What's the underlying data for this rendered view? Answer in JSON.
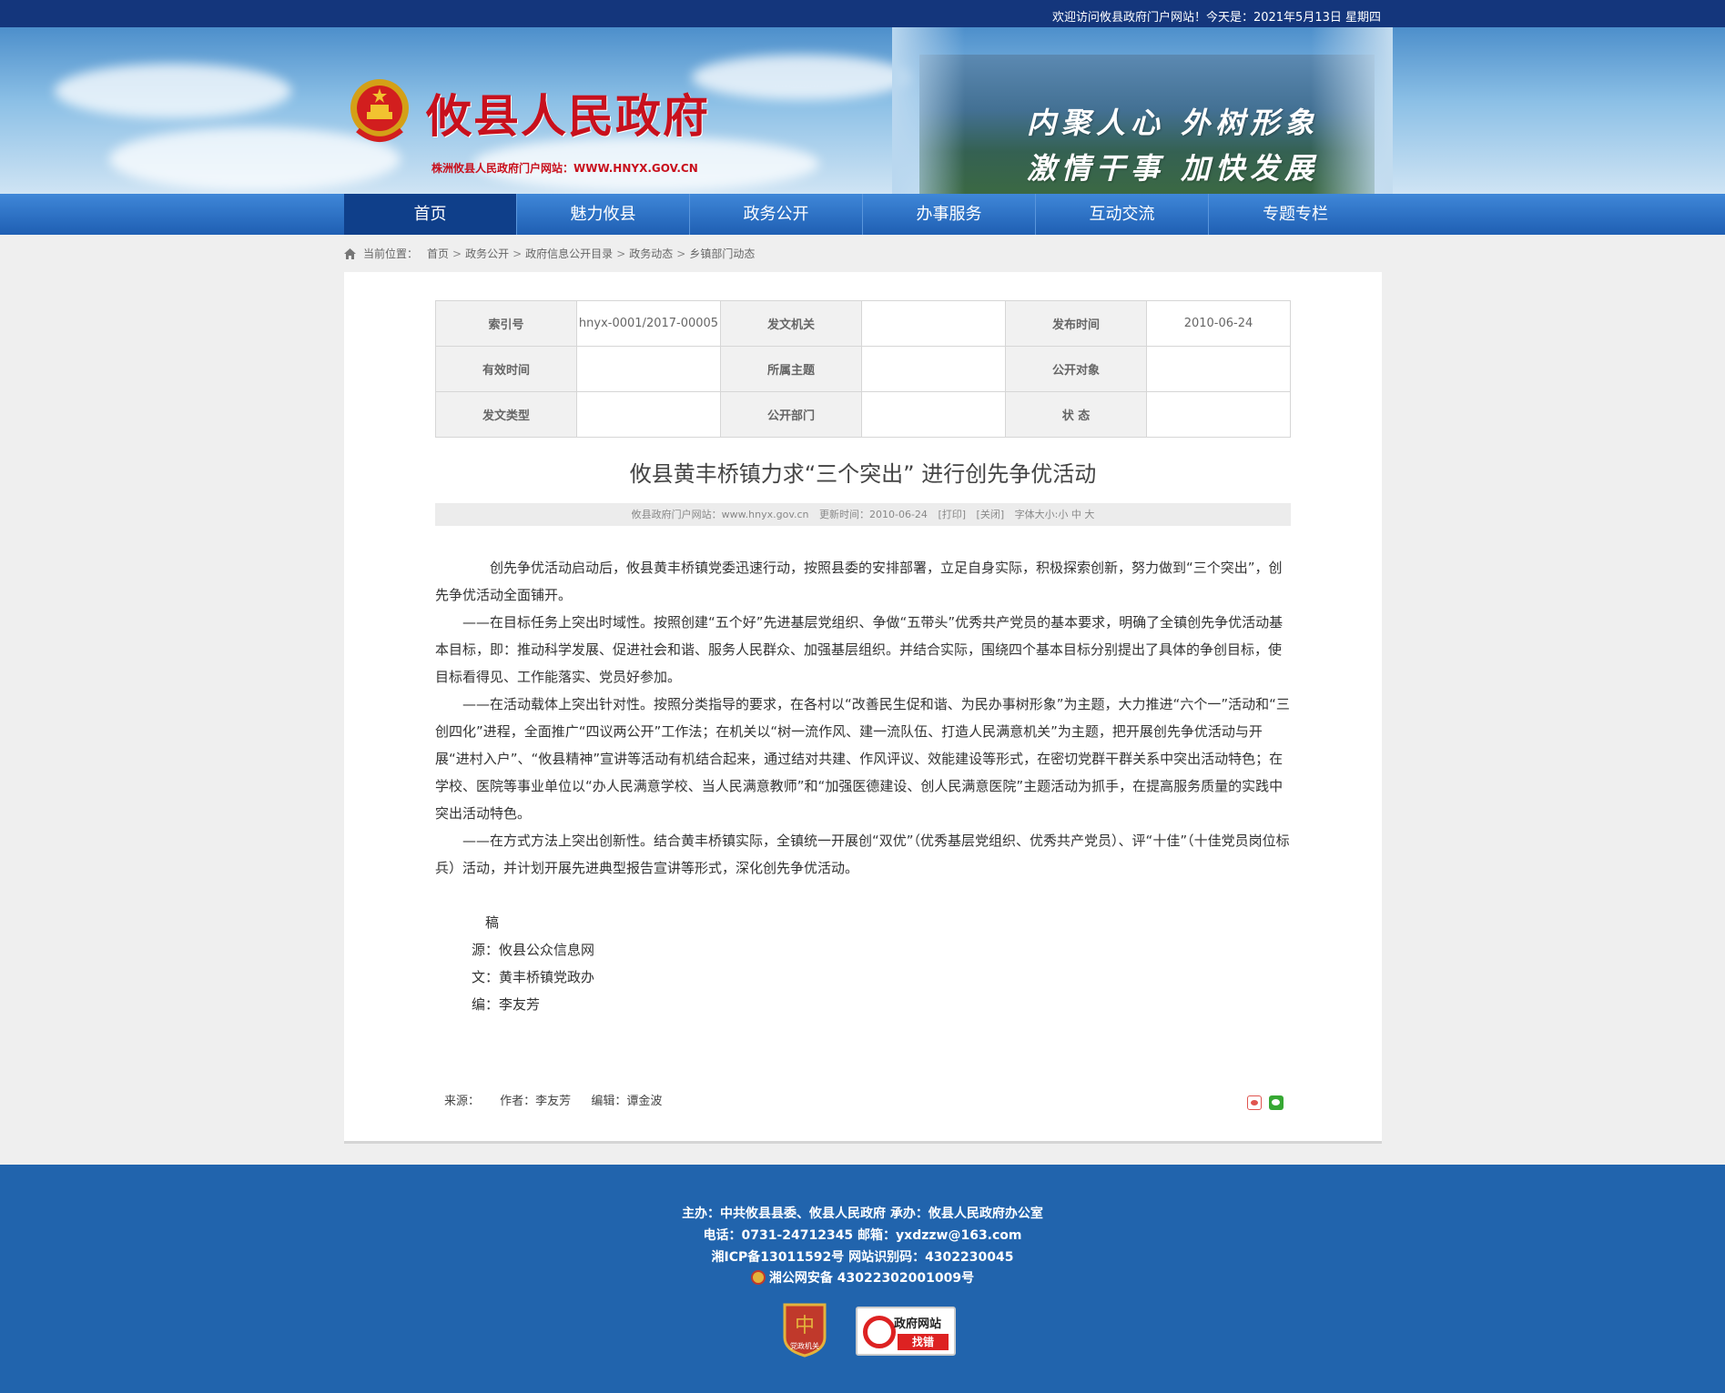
{
  "topbar": {
    "welcome": "欢迎访问攸县政府门户网站！今天是：2021年5月13日 星期四"
  },
  "header": {
    "site_title": "攸县人民政府",
    "site_subtitle": "株洲攸县人民政府门户网站：WWW.HNYX.GOV.CN",
    "slogan_line1": "内聚人心  外树形象",
    "slogan_line2": "激情干事  加快发展"
  },
  "nav": {
    "items": [
      "首页",
      "魅力攸县",
      "政务公开",
      "办事服务",
      "互动交流",
      "专题专栏"
    ],
    "active": "首页"
  },
  "breadcrumb": {
    "label": "当前位置：",
    "items": [
      "首页",
      "政务公开",
      "政府信息公开目录",
      "政务动态",
      "乡镇部门动态"
    ]
  },
  "meta": {
    "index_no_label": "索引号",
    "index_no": "hnyx-0001/2017-00005",
    "issuer_label": "发文机关",
    "issuer": "",
    "publish_time_label": "发布时间",
    "publish_time": "2010-06-24",
    "valid_time_label": "有效时间",
    "valid_time": "",
    "topic_label": "所属主题",
    "topic": "",
    "audience_label": "公开对象",
    "audience": "",
    "doc_type_label": "发文类型",
    "doc_type": "",
    "dept_label": "公开部门",
    "dept": "",
    "status_label": "状 态",
    "status": ""
  },
  "article": {
    "title": "攸县黄丰桥镇力求“三个突出” 进行创先争优活动",
    "info_site": "攸县政府门户网站：www.hnyx.gov.cn",
    "info_time": "更新时间：2010-06-24",
    "info_print": "[打印]",
    "info_close": "[关闭]",
    "info_font": "字体大小:小 中 大",
    "paragraphs": [
      "创先争优活动启动后，攸县黄丰桥镇党委迅速行动，按照县委的安排部署，立足自身实际，积极探索创新，努力做到“三个突出”，创先争优活动全面铺开。",
      "——在目标任务上突出时域性。按照创建“五个好”先进基层党组织、争做“五带头”优秀共产党员的基本要求，明确了全镇创先争优活动基本目标，即：推动科学发展、促进社会和谐、服务人民群众、加强基层组织。并结合实际，围绕四个基本目标分别提出了具体的争创目标，使目标看得见、工作能落实、党员好参加。",
      "——在活动载体上突出针对性。按照分类指导的要求，在各村以“改善民生促和谐、为民办事树形象”为主题，大力推进“六个一”活动和“三创四化”进程，全面推广“四议两公开”工作法；在机关以“树一流作风、建一流队伍、打造人民满意机关”为主题，把开展创先争优活动与开展“进村入户”、“攸县精神”宣讲等活动有机结合起来，通过结对共建、作风评议、效能建设等形式，在密切党群干群关系中突出活动特色；在学校、医院等事业单位以“办人民满意学校、当人民满意教师”和“加强医德建设、创人民满意医院”主题活动为抓手，在提高服务质量的实践中突出活动特色。",
      "——在方式方法上突出创新性。结合黄丰桥镇实际，全镇统一开展创“双优”（优秀基层党组织、优秀共产党员）、评“十佳”（十佳党员岗位标兵）活动，并计划开展先进典型报告宣讲等形式，深化创先争优活动。"
    ],
    "credit_source_label": "稿源：",
    "credit_source": "攸县公众信息网",
    "credit_text_label": "文：",
    "credit_text": "黄丰桥镇党政办",
    "credit_editor_label": "编：",
    "credit_editor": "李友芳",
    "byline_source": "来源：",
    "byline_author": "作者：李友芳",
    "byline_editor": "编辑：谭金波"
  },
  "footer": {
    "line1": "主办：中共攸县县委、攸县人民政府 承办：攸县人民政府办公室",
    "line2": "电话：0731-24712345 邮箱：yxdzzw@163.com",
    "line3": "湘ICP备13011592号    网站识别码：4302230045",
    "line4": "湘公网安备 43022302001009号",
    "party_badge": "党政机关",
    "findbug_title": "政府网站",
    "findbug_action": "找错"
  },
  "colors": {
    "topbar": "#14367c",
    "nav": "#1f5fb3",
    "footer": "#2164ad",
    "title_red": "#c8101d"
  }
}
